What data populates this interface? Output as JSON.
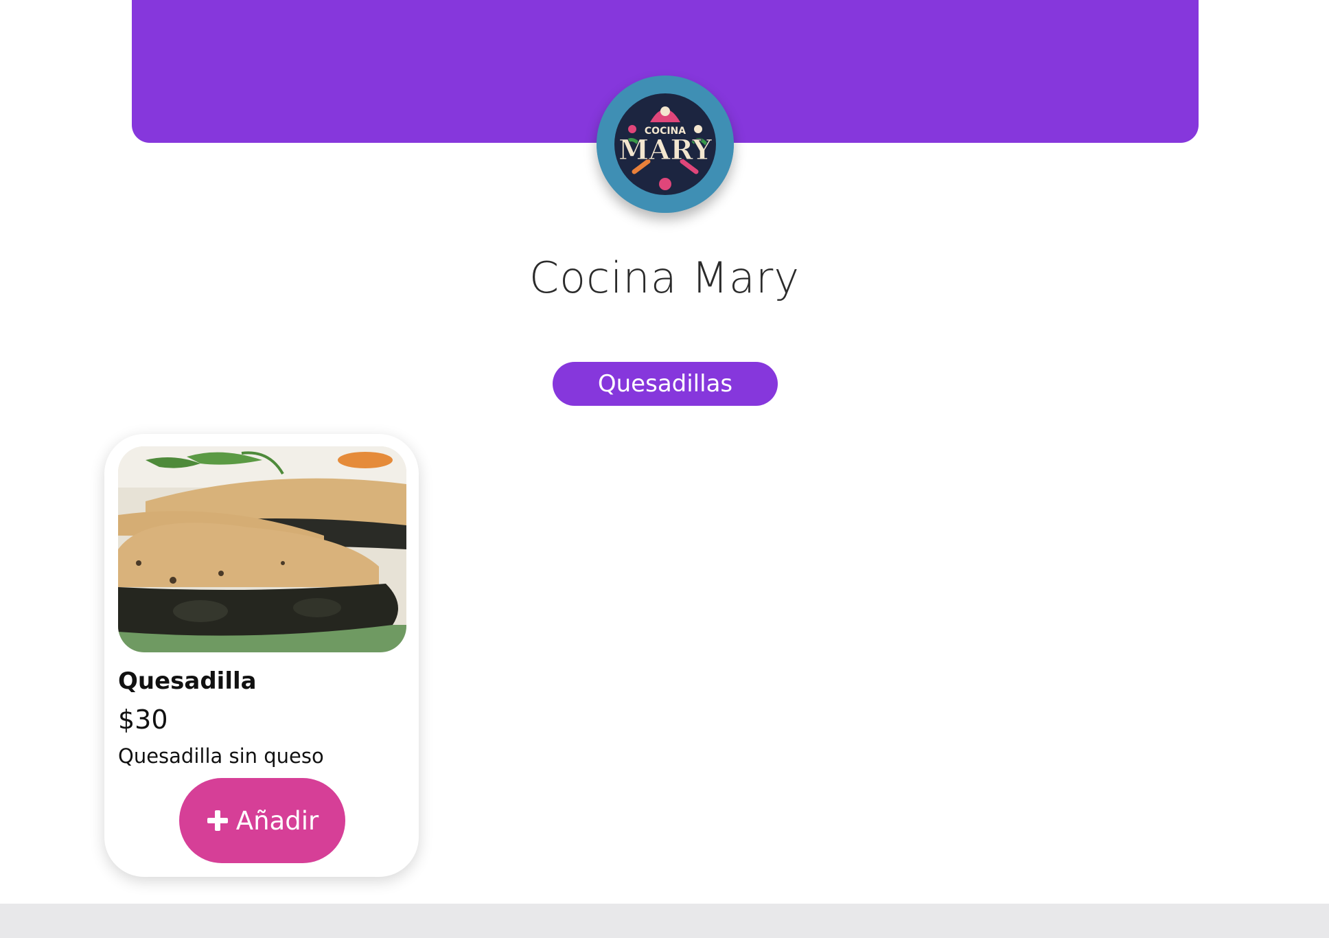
{
  "header": {
    "banner_color": "#8637dc",
    "logo": {
      "icon": "restaurant-logo-icon",
      "top_text": "COCINA",
      "main_text": "MARY",
      "background": "#3f8fb4"
    }
  },
  "restaurant": {
    "name": "Cocina Mary"
  },
  "categories": [
    {
      "label": "Quesadillas",
      "color": "#8637dc"
    }
  ],
  "products": [
    {
      "image_icon": "quesadilla-photo",
      "name": "Quesadilla",
      "price": "$30",
      "description": "Quesadilla sin queso",
      "add_label": "Añadir",
      "add_icon": "plus-icon",
      "button_color": "#d63f97"
    }
  ]
}
